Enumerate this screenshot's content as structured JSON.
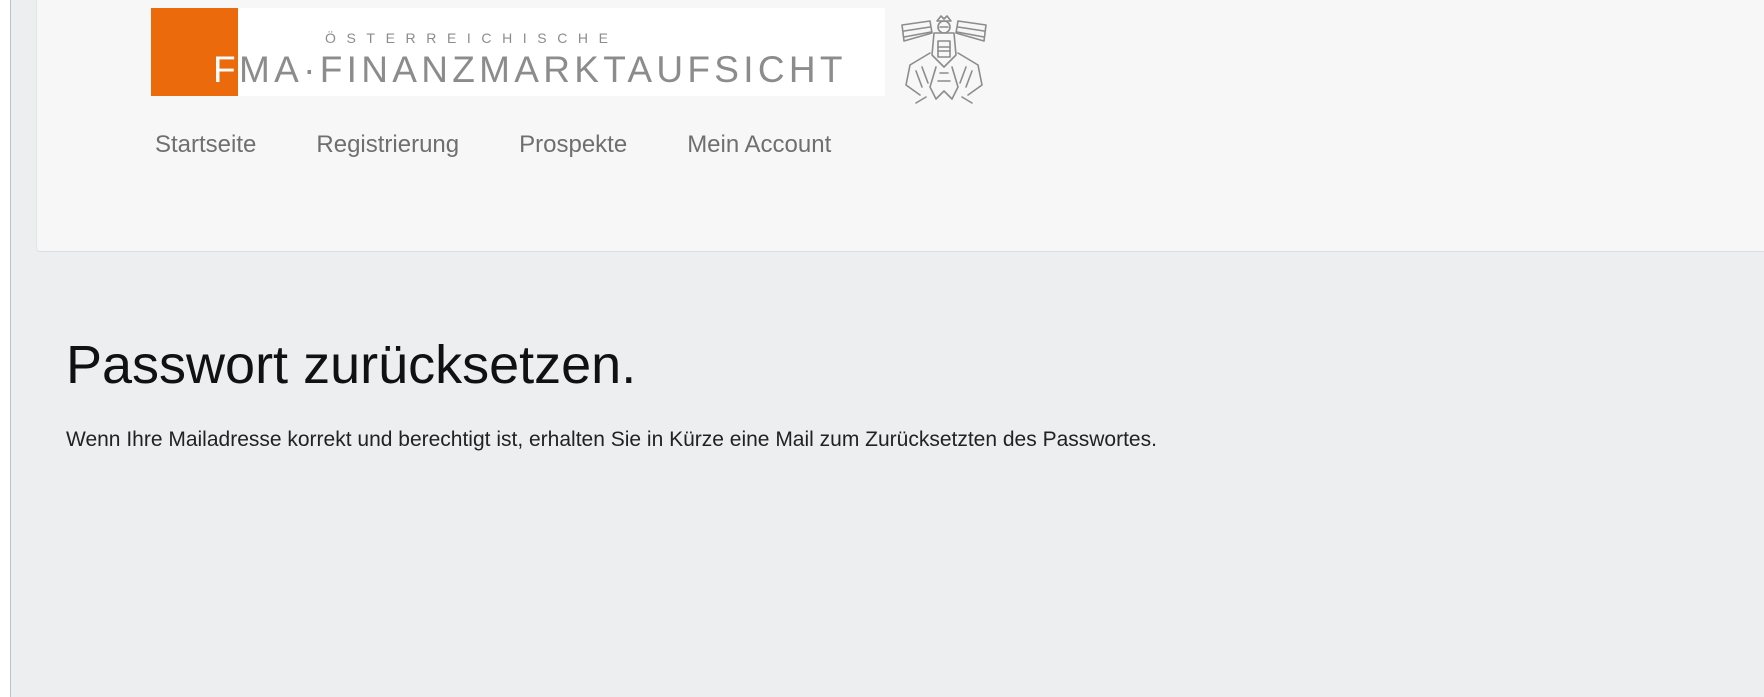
{
  "logo": {
    "small_text": "ÖSTERREICHISCHE",
    "letter": "F",
    "main_text": "MA·FINANZMARKTAUFSICHT",
    "accent_color": "#eb6a0c"
  },
  "nav": {
    "items": [
      {
        "label": "Startseite"
      },
      {
        "label": "Registrierung"
      },
      {
        "label": "Prospekte"
      },
      {
        "label": "Mein Account"
      }
    ]
  },
  "main": {
    "title": "Passwort zurücksetzen.",
    "message": "Wenn Ihre Mailadresse korrekt und berechtigt ist, erhalten Sie in Kürze eine Mail zum Zurücksetzten des Passwortes."
  }
}
